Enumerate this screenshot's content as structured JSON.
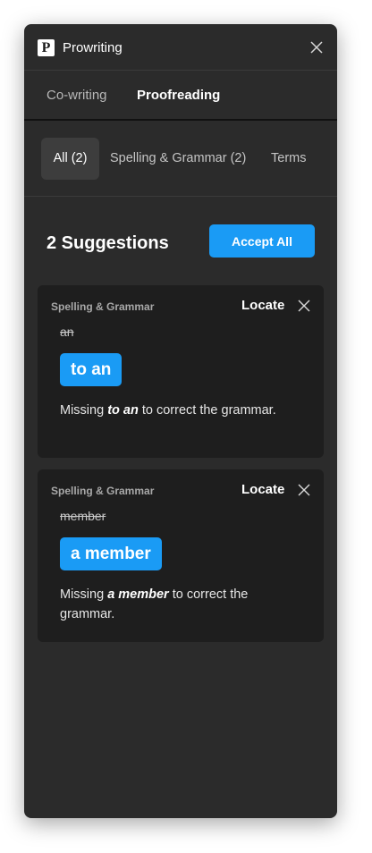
{
  "app": {
    "logo_letter": "P",
    "title": "Prowriting"
  },
  "tabs": [
    {
      "label": "Co-writing",
      "active": false
    },
    {
      "label": "Proofreading",
      "active": true
    }
  ],
  "filters": [
    {
      "label": "All (2)",
      "active": true
    },
    {
      "label": "Spelling & Grammar (2)",
      "active": false
    },
    {
      "label": "Terms",
      "active": false
    }
  ],
  "summary": {
    "title": "2 Suggestions",
    "accept_all_label": "Accept All"
  },
  "suggestions": [
    {
      "category": "Spelling & Grammar",
      "locate_label": "Locate",
      "original": "an",
      "replacement": "to an",
      "message_prefix": "Missing ",
      "message_emphasis": "to an",
      "message_suffix": " to correct the grammar."
    },
    {
      "category": "Spelling & Grammar",
      "locate_label": "Locate",
      "original": "member",
      "replacement": "a member",
      "message_prefix": "Missing ",
      "message_emphasis": "a member",
      "message_suffix": " to correct the grammar."
    }
  ],
  "colors": {
    "panel_background": "#2b2b2b",
    "card_background": "#1e1e1e",
    "accent": "#1a9bf5"
  },
  "icons": {
    "close": "close-icon",
    "dismiss": "close-icon",
    "logo": "prowriting-logo"
  }
}
